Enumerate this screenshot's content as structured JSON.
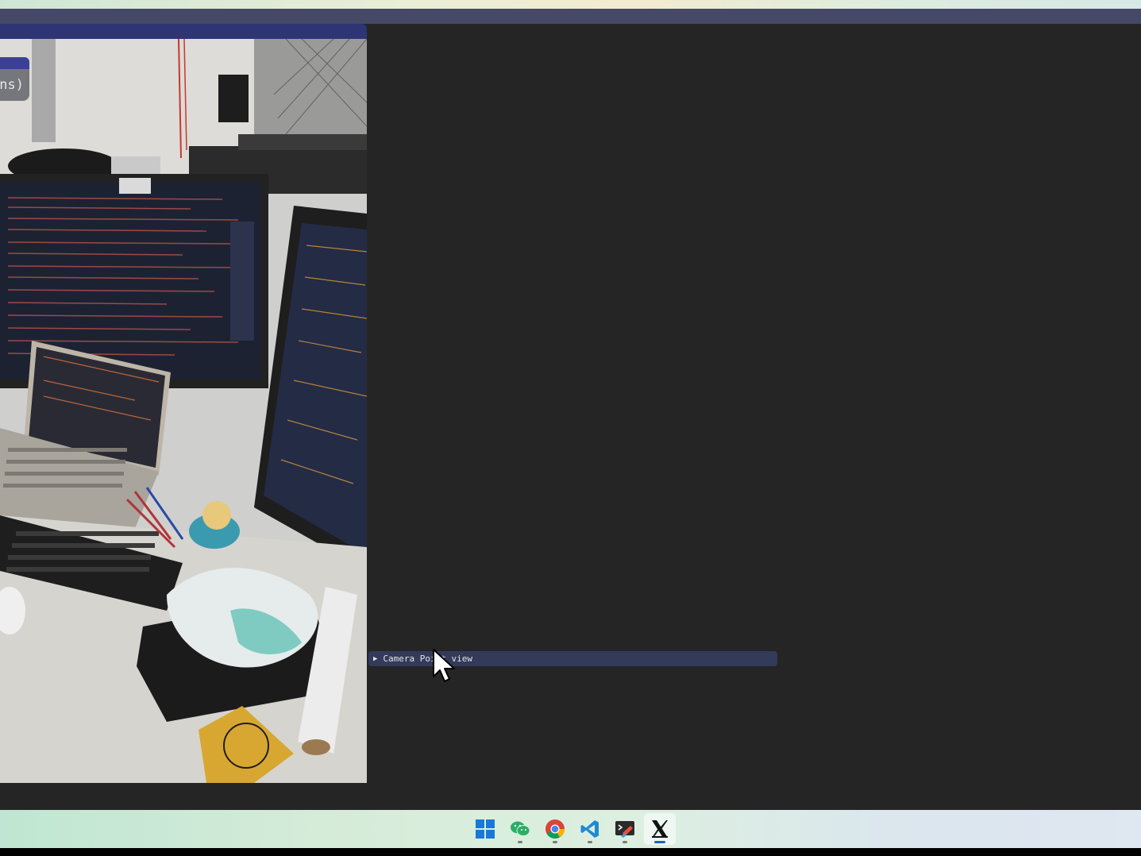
{
  "viewer": {
    "overlay_tooltip_text": "ns)"
  },
  "panel": {
    "collapsing_header_label": "Camera Point view",
    "collapsing_header_state": "collapsed"
  },
  "taskbar": {
    "items": [
      {
        "icon": "windows-start-icon",
        "active": false,
        "running": false
      },
      {
        "icon": "wechat-icon",
        "active": false,
        "running": true
      },
      {
        "icon": "chrome-icon",
        "active": false,
        "running": true
      },
      {
        "icon": "vscode-icon",
        "active": false,
        "running": true
      },
      {
        "icon": "terminal-icon",
        "active": false,
        "running": true
      },
      {
        "icon": "x-app-icon",
        "active": true,
        "running": true
      }
    ]
  },
  "colors": {
    "title_bar": "#454867",
    "viewer_header": "#2e3574",
    "collapsing_header": "#343a5a",
    "app_background": "#252526"
  }
}
